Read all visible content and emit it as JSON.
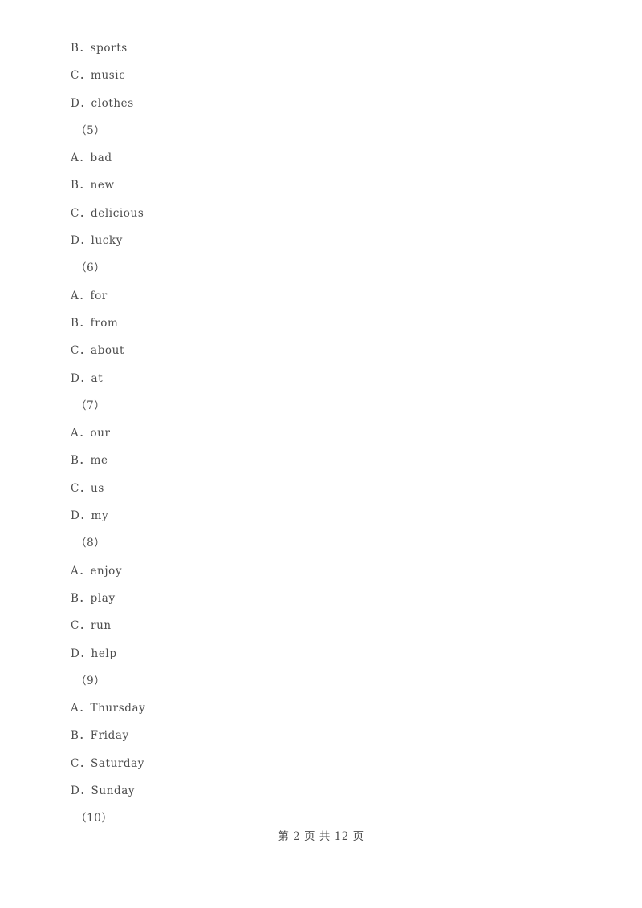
{
  "document": {
    "background_color": "#ffffff",
    "text_color": "#4d4d4d"
  },
  "lines": [
    {
      "kind": "option",
      "letter": "B",
      "separator": "．",
      "text": "sports"
    },
    {
      "kind": "option",
      "letter": "C",
      "separator": "．",
      "text": "music"
    },
    {
      "kind": "option",
      "letter": "D",
      "separator": "．",
      "text": "clothes"
    },
    {
      "kind": "question",
      "number": "（5）"
    },
    {
      "kind": "option",
      "letter": "A",
      "separator": "．",
      "text": "bad"
    },
    {
      "kind": "option",
      "letter": "B",
      "separator": "．",
      "text": "new"
    },
    {
      "kind": "option",
      "letter": "C",
      "separator": "．",
      "text": "delicious"
    },
    {
      "kind": "option",
      "letter": "D",
      "separator": "．",
      "text": "lucky"
    },
    {
      "kind": "question",
      "number": "（6）"
    },
    {
      "kind": "option",
      "letter": "A",
      "separator": "．",
      "text": "for"
    },
    {
      "kind": "option",
      "letter": "B",
      "separator": "．",
      "text": "from"
    },
    {
      "kind": "option",
      "letter": "C",
      "separator": "．",
      "text": "about"
    },
    {
      "kind": "option",
      "letter": "D",
      "separator": "．",
      "text": "at"
    },
    {
      "kind": "question",
      "number": "（7）"
    },
    {
      "kind": "option",
      "letter": "A",
      "separator": "．",
      "text": "our"
    },
    {
      "kind": "option",
      "letter": "B",
      "separator": "．",
      "text": "me"
    },
    {
      "kind": "option",
      "letter": "C",
      "separator": "．",
      "text": "us"
    },
    {
      "kind": "option",
      "letter": "D",
      "separator": "．",
      "text": "my"
    },
    {
      "kind": "question",
      "number": "（8）"
    },
    {
      "kind": "option",
      "letter": "A",
      "separator": "．",
      "text": "enjoy"
    },
    {
      "kind": "option",
      "letter": "B",
      "separator": "．",
      "text": "play"
    },
    {
      "kind": "option",
      "letter": "C",
      "separator": "．",
      "text": "run"
    },
    {
      "kind": "option",
      "letter": "D",
      "separator": "．",
      "text": "help"
    },
    {
      "kind": "question",
      "number": "（9）"
    },
    {
      "kind": "option",
      "letter": "A",
      "separator": "．",
      "text": "Thursday"
    },
    {
      "kind": "option",
      "letter": "B",
      "separator": "．",
      "text": "Friday"
    },
    {
      "kind": "option",
      "letter": "C",
      "separator": "．",
      "text": "Saturday"
    },
    {
      "kind": "option",
      "letter": "D",
      "separator": "．",
      "text": "Sunday"
    },
    {
      "kind": "question",
      "number": "（10）"
    }
  ],
  "footer": {
    "text": "第 2 页 共 12 页",
    "current_page": "2",
    "total_pages": "12"
  }
}
